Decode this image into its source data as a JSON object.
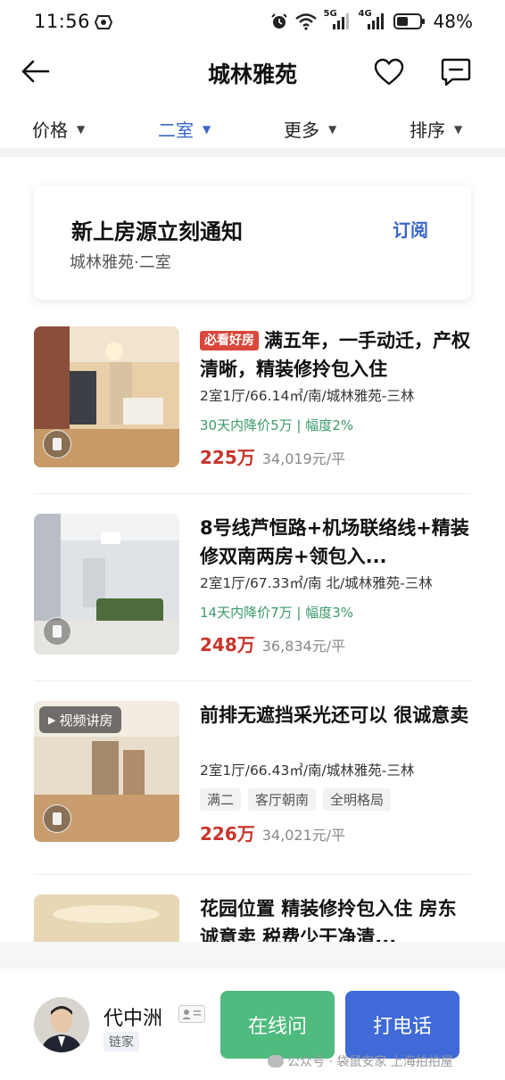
{
  "status_bar": {
    "time": "11:56",
    "network_1": "5G",
    "network_2": "4G",
    "battery": "48%"
  },
  "nav": {
    "title": "城林雅苑",
    "icons": [
      "back-arrow-icon",
      "heart-icon",
      "message-icon"
    ]
  },
  "filters": [
    {
      "label": "价格",
      "active": false
    },
    {
      "label": "二室",
      "active": true
    },
    {
      "label": "更多",
      "active": false
    },
    {
      "label": "排序",
      "active": false
    }
  ],
  "subscribe": {
    "title": "新上房源立刻通知",
    "subtitle": "城林雅苑·二室",
    "button": "订阅"
  },
  "listings": [
    {
      "badge": "必看好房",
      "title": "满五年，一手动迁，产权清晰，精装修拎包入住",
      "desc": "2室1厅/66.14㎡/南/城林雅苑-三林",
      "drop": "30天内降价5万 | 幅度2%",
      "price": "225万",
      "unit_price": "34,019元/平"
    },
    {
      "title": "8号线芦恒路+机场联络线+精装修双南两房+领包入...",
      "desc": "2室1厅/67.33㎡/南 北/城林雅苑-三林",
      "drop": "14天内降价7万 | 幅度3%",
      "price": "248万",
      "unit_price": "36,834元/平"
    },
    {
      "video_tag": "视频讲房",
      "title": "前排无遮挡采光还可以 很诚意卖",
      "desc": "2室1厅/66.43㎡/南/城林雅苑-三林",
      "tags": [
        "满二",
        "客厅朝南",
        "全明格局"
      ],
      "price": "226万",
      "unit_price": "34,021元/平"
    },
    {
      "title": "花园位置 精装修拎包入住 房东诚意卖 税费少干净清..."
    }
  ],
  "agent": {
    "name": "代中洲",
    "company": "链家",
    "chat_button": "在线问",
    "call_button": "打电话"
  },
  "watermark": "公众号 · 袋鼠安家 上海拍拍屋",
  "colors": {
    "accent_blue": "#3a66c8",
    "price_red": "#c8342a",
    "drop_green": "#3b9a6a",
    "chat_green": "#4fbb7f",
    "call_blue": "#3f6ad8"
  }
}
